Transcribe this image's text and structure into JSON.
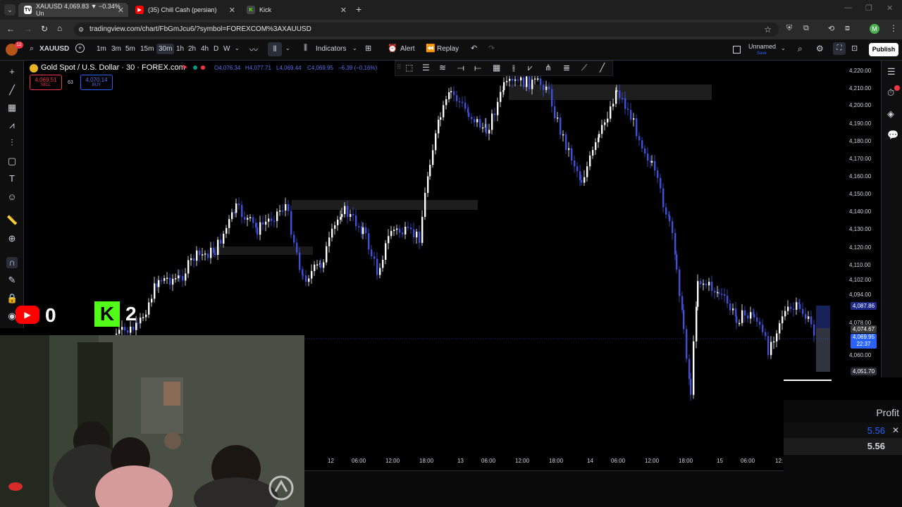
{
  "browser": {
    "tabs": [
      {
        "title": "XAUUSD 4,069.83 ▼ −0.34% Un",
        "icon": "tradingview-icon"
      },
      {
        "title": "(35) Chill Cash (persian)",
        "icon": "youtube-icon"
      },
      {
        "title": "Kick",
        "icon": "kick-icon"
      }
    ],
    "new_tab": "+",
    "url": "tradingview.com/chart/FbGmJcu6/?symbol=FOREXCOM%3AXAUUSD",
    "profile_initial": "M"
  },
  "toolbar": {
    "notification_count": "12",
    "symbol": "XAUUSD",
    "intervals": [
      "1m",
      "3m",
      "5m",
      "15m",
      "30m",
      "1h",
      "2h",
      "4h",
      "D",
      "W"
    ],
    "active_interval": "30m",
    "indicators_label": "Indicators",
    "alert_label": "Alert",
    "replay_label": "Replay",
    "layout_name": "Unnamed",
    "layout_sub": "Save",
    "publish_label": "Publish"
  },
  "legend": {
    "title": "Gold Spot / U.S. Dollar · 30 · FOREX.com",
    "open": "O4,076.34",
    "high": "H4,077.71",
    "low": "L4,069.44",
    "close": "C4,069.95",
    "change": "−6.39 (−0.16%)",
    "sell_price": "4,069.51",
    "sell_label": "SELL",
    "spread": "63",
    "buy_price": "4,070.14",
    "buy_label": "BUY"
  },
  "price_axis": {
    "labels": [
      "4,220.00",
      "4,210.00",
      "4,200.00",
      "4,190.00",
      "4,180.00",
      "4,170.00",
      "4,160.00",
      "4,150.00",
      "4,140.00",
      "4,130.00",
      "4,120.00",
      "4,110.00",
      "4,102.00",
      "4,094.00",
      "4,078.00",
      "4,060.00"
    ],
    "tag_high": "4,087.86",
    "tag_mid": "4,074.67",
    "tag_last": "4,069.95",
    "tag_countdown": "22:37",
    "tag_low": "4,051.70"
  },
  "time_axis": {
    "labels": [
      "12",
      "06:00",
      "12:00",
      "18:00",
      "13",
      "06:00",
      "12:00",
      "18:00",
      "14",
      "06:00",
      "12:00",
      "18:00",
      "15",
      "06:00",
      "12:"
    ]
  },
  "overlay": {
    "youtube_count": "0",
    "kick_count": "2"
  },
  "profit_panel": {
    "label": "Profit",
    "value_1": "5.56",
    "value_2": "5.56"
  },
  "colors": {
    "bull": "#ffffff",
    "bear": "#3f51d8",
    "accent": "#2962ff",
    "sell": "#f23645"
  }
}
